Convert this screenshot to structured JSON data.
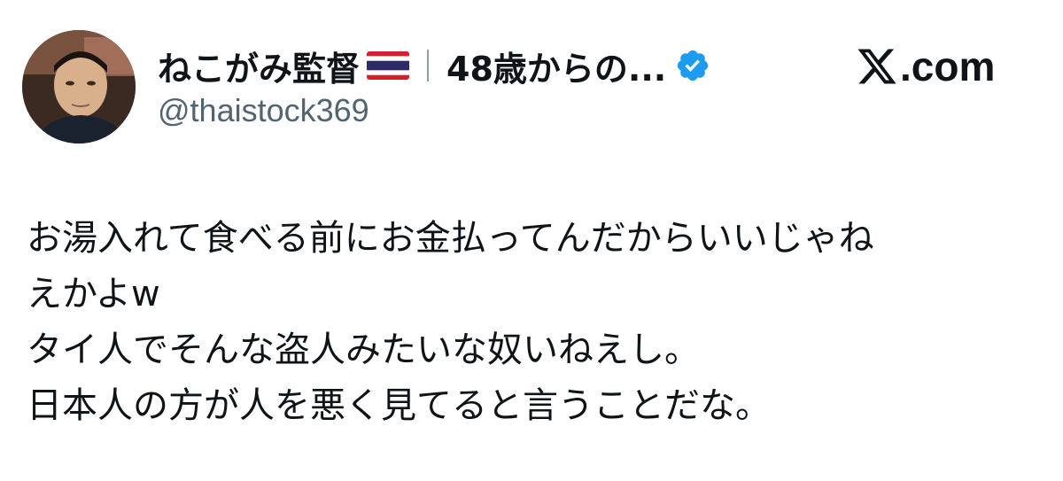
{
  "author": {
    "display_name": "ねこがみ監督",
    "flag_icon": "thailand-flag-icon",
    "bio_snippet": "48歳からの...",
    "verified_icon": "verified-badge-icon",
    "verified_color": "#1d9bf0",
    "handle": "@thaistock369"
  },
  "brand": {
    "logo_icon": "x-logo-icon",
    "text": ".com"
  },
  "tweet": {
    "lines": [
      "お湯入れて食べる前にお金払ってんだからいいじゃね",
      "えかよw",
      "タイ人でそんな盗人みたいな奴いねえし。",
      "日本人の方が人を悪く見てると言うことだな。"
    ]
  },
  "colors": {
    "text": "#0f1419",
    "secondary_text": "#536471",
    "separator": "#8f9aa5"
  }
}
